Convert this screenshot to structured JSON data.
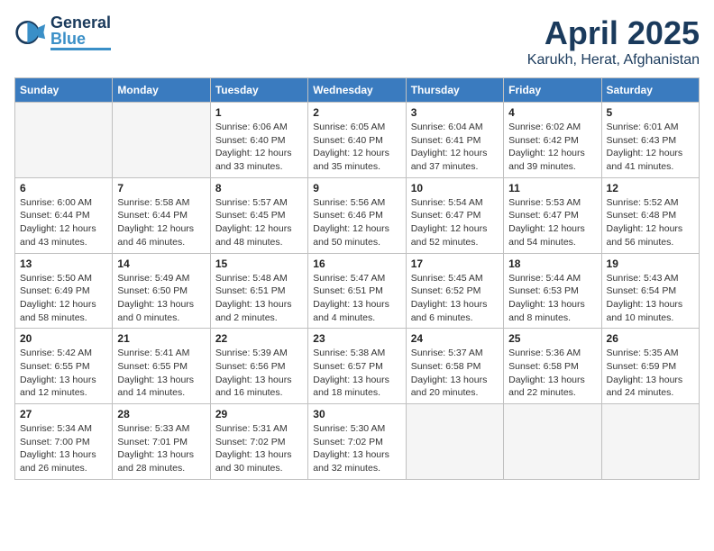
{
  "header": {
    "logo_general": "General",
    "logo_blue": "Blue",
    "title": "April 2025",
    "subtitle": "Karukh, Herat, Afghanistan"
  },
  "days_of_week": [
    "Sunday",
    "Monday",
    "Tuesday",
    "Wednesday",
    "Thursday",
    "Friday",
    "Saturday"
  ],
  "weeks": [
    [
      {
        "day": "",
        "info": ""
      },
      {
        "day": "",
        "info": ""
      },
      {
        "day": "1",
        "info": "Sunrise: 6:06 AM\nSunset: 6:40 PM\nDaylight: 12 hours\nand 33 minutes."
      },
      {
        "day": "2",
        "info": "Sunrise: 6:05 AM\nSunset: 6:40 PM\nDaylight: 12 hours\nand 35 minutes."
      },
      {
        "day": "3",
        "info": "Sunrise: 6:04 AM\nSunset: 6:41 PM\nDaylight: 12 hours\nand 37 minutes."
      },
      {
        "day": "4",
        "info": "Sunrise: 6:02 AM\nSunset: 6:42 PM\nDaylight: 12 hours\nand 39 minutes."
      },
      {
        "day": "5",
        "info": "Sunrise: 6:01 AM\nSunset: 6:43 PM\nDaylight: 12 hours\nand 41 minutes."
      }
    ],
    [
      {
        "day": "6",
        "info": "Sunrise: 6:00 AM\nSunset: 6:44 PM\nDaylight: 12 hours\nand 43 minutes."
      },
      {
        "day": "7",
        "info": "Sunrise: 5:58 AM\nSunset: 6:44 PM\nDaylight: 12 hours\nand 46 minutes."
      },
      {
        "day": "8",
        "info": "Sunrise: 5:57 AM\nSunset: 6:45 PM\nDaylight: 12 hours\nand 48 minutes."
      },
      {
        "day": "9",
        "info": "Sunrise: 5:56 AM\nSunset: 6:46 PM\nDaylight: 12 hours\nand 50 minutes."
      },
      {
        "day": "10",
        "info": "Sunrise: 5:54 AM\nSunset: 6:47 PM\nDaylight: 12 hours\nand 52 minutes."
      },
      {
        "day": "11",
        "info": "Sunrise: 5:53 AM\nSunset: 6:47 PM\nDaylight: 12 hours\nand 54 minutes."
      },
      {
        "day": "12",
        "info": "Sunrise: 5:52 AM\nSunset: 6:48 PM\nDaylight: 12 hours\nand 56 minutes."
      }
    ],
    [
      {
        "day": "13",
        "info": "Sunrise: 5:50 AM\nSunset: 6:49 PM\nDaylight: 12 hours\nand 58 minutes."
      },
      {
        "day": "14",
        "info": "Sunrise: 5:49 AM\nSunset: 6:50 PM\nDaylight: 13 hours\nand 0 minutes."
      },
      {
        "day": "15",
        "info": "Sunrise: 5:48 AM\nSunset: 6:51 PM\nDaylight: 13 hours\nand 2 minutes."
      },
      {
        "day": "16",
        "info": "Sunrise: 5:47 AM\nSunset: 6:51 PM\nDaylight: 13 hours\nand 4 minutes."
      },
      {
        "day": "17",
        "info": "Sunrise: 5:45 AM\nSunset: 6:52 PM\nDaylight: 13 hours\nand 6 minutes."
      },
      {
        "day": "18",
        "info": "Sunrise: 5:44 AM\nSunset: 6:53 PM\nDaylight: 13 hours\nand 8 minutes."
      },
      {
        "day": "19",
        "info": "Sunrise: 5:43 AM\nSunset: 6:54 PM\nDaylight: 13 hours\nand 10 minutes."
      }
    ],
    [
      {
        "day": "20",
        "info": "Sunrise: 5:42 AM\nSunset: 6:55 PM\nDaylight: 13 hours\nand 12 minutes."
      },
      {
        "day": "21",
        "info": "Sunrise: 5:41 AM\nSunset: 6:55 PM\nDaylight: 13 hours\nand 14 minutes."
      },
      {
        "day": "22",
        "info": "Sunrise: 5:39 AM\nSunset: 6:56 PM\nDaylight: 13 hours\nand 16 minutes."
      },
      {
        "day": "23",
        "info": "Sunrise: 5:38 AM\nSunset: 6:57 PM\nDaylight: 13 hours\nand 18 minutes."
      },
      {
        "day": "24",
        "info": "Sunrise: 5:37 AM\nSunset: 6:58 PM\nDaylight: 13 hours\nand 20 minutes."
      },
      {
        "day": "25",
        "info": "Sunrise: 5:36 AM\nSunset: 6:58 PM\nDaylight: 13 hours\nand 22 minutes."
      },
      {
        "day": "26",
        "info": "Sunrise: 5:35 AM\nSunset: 6:59 PM\nDaylight: 13 hours\nand 24 minutes."
      }
    ],
    [
      {
        "day": "27",
        "info": "Sunrise: 5:34 AM\nSunset: 7:00 PM\nDaylight: 13 hours\nand 26 minutes."
      },
      {
        "day": "28",
        "info": "Sunrise: 5:33 AM\nSunset: 7:01 PM\nDaylight: 13 hours\nand 28 minutes."
      },
      {
        "day": "29",
        "info": "Sunrise: 5:31 AM\nSunset: 7:02 PM\nDaylight: 13 hours\nand 30 minutes."
      },
      {
        "day": "30",
        "info": "Sunrise: 5:30 AM\nSunset: 7:02 PM\nDaylight: 13 hours\nand 32 minutes."
      },
      {
        "day": "",
        "info": ""
      },
      {
        "day": "",
        "info": ""
      },
      {
        "day": "",
        "info": ""
      }
    ]
  ]
}
